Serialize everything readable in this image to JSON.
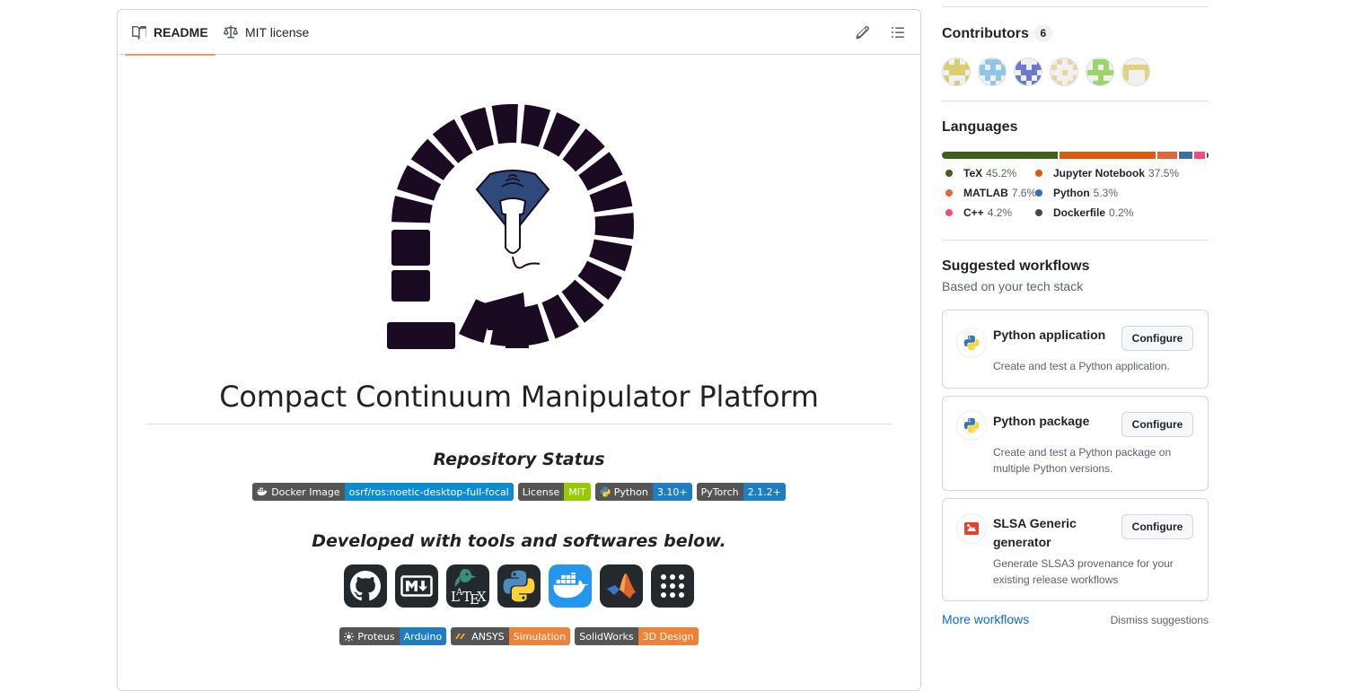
{
  "readme": {
    "tabs": [
      {
        "label": "README",
        "icon": "book-icon",
        "active": true
      },
      {
        "label": "MIT license",
        "icon": "scale-icon",
        "active": false
      }
    ],
    "actions": {
      "edit_icon": "pencil-icon",
      "outline_icon": "list-unordered-icon"
    },
    "logo_icon": "ultrasound-probe-logo",
    "title": "Compact Continuum Manipulator Platform",
    "status_heading": "Repository Status",
    "status_badges": [
      {
        "label": "Docker Image",
        "value": "osrf/ros:noetic-desktop-full-focal",
        "color": "#0d8bcf",
        "icon": "docker-icon"
      },
      {
        "label": "License",
        "value": "MIT",
        "color": "#97ca00",
        "icon": ""
      },
      {
        "label": "Python",
        "value": "3.10+",
        "color": "#1f7ec2",
        "icon": "python-icon"
      },
      {
        "label": "PyTorch",
        "value": "2.1.2+",
        "color": "#1f7ec2",
        "icon": ""
      }
    ],
    "tools_heading": "Developed with tools and softwares below.",
    "tools": [
      {
        "name": "github-icon",
        "bg": "#24292e"
      },
      {
        "name": "markdown-icon",
        "bg": "#24292e"
      },
      {
        "name": "latex-icon",
        "bg": "#24292e"
      },
      {
        "name": "python-icon",
        "bg": "#24292e"
      },
      {
        "name": "docker-icon",
        "bg": "#2496ed"
      },
      {
        "name": "matlab-icon",
        "bg": "#24292e"
      },
      {
        "name": "dots-grid-icon",
        "bg": "#24292e"
      }
    ],
    "tool_badges": [
      {
        "label": "Proteus",
        "value": "Arduino",
        "color": "#1f7ec2",
        "icon": "sun-icon"
      },
      {
        "label": "ANSYS",
        "value": "Simulation",
        "color": "#ef8236",
        "icon": "ansys-icon"
      },
      {
        "label": "SolidWorks",
        "value": "3D Design",
        "color": "#ef8236",
        "icon": ""
      }
    ]
  },
  "sidebar": {
    "contributors": {
      "heading": "Contributors",
      "count": "6",
      "avatar_colors": [
        "#d9cf6f",
        "#8ec6e8",
        "#6b79d1",
        "#e8d5a8",
        "#9bd56b",
        "#e2d083"
      ]
    },
    "languages": {
      "heading": "Languages",
      "items": [
        {
          "name": "TeX",
          "pct": "45.2%",
          "value": 45.2,
          "color": "#3d6117"
        },
        {
          "name": "Jupyter Notebook",
          "pct": "37.5%",
          "value": 37.5,
          "color": "#da5b0b"
        },
        {
          "name": "MATLAB",
          "pct": "7.6%",
          "value": 7.6,
          "color": "#e16737"
        },
        {
          "name": "Python",
          "pct": "5.3%",
          "value": 5.3,
          "color": "#3572a5"
        },
        {
          "name": "C++",
          "pct": "4.2%",
          "value": 4.2,
          "color": "#f34b7d"
        },
        {
          "name": "Dockerfile",
          "pct": "0.2%",
          "value": 0.2,
          "color": "#384d54"
        }
      ]
    },
    "workflows": {
      "heading": "Suggested workflows",
      "subheading": "Based on your tech stack",
      "cards": [
        {
          "title": "Python application",
          "desc": "Create and test a Python application.",
          "button": "Configure",
          "icon": "python-icon"
        },
        {
          "title": "Python package",
          "desc": "Create and test a Python package on multiple Python versions.",
          "button": "Configure",
          "icon": "python-icon"
        },
        {
          "title": "SLSA Generic generator",
          "desc": "Generate SLSA3 provenance for your existing release workflows",
          "button": "Configure",
          "icon": "slsa-icon"
        }
      ],
      "more_link": "More workflows",
      "dismiss_link": "Dismiss suggestions"
    }
  }
}
